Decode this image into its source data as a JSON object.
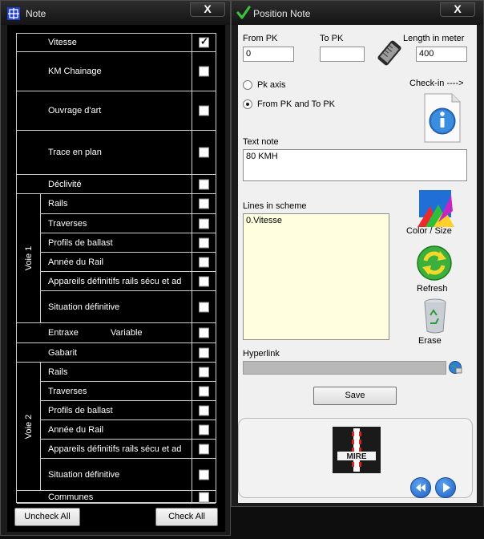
{
  "note_window": {
    "title": "Note",
    "close_label": "X",
    "rows": [
      {
        "label": "Vitesse",
        "checked": true
      },
      {
        "label": "KM Chainage",
        "checked": false
      },
      {
        "label": "Ouvrage d'art",
        "checked": false
      },
      {
        "label": "Trace en plan",
        "checked": false
      },
      {
        "label": "Déclivité",
        "checked": false
      },
      {
        "label": "Rails",
        "checked": false
      },
      {
        "label": "Traverses",
        "checked": false
      },
      {
        "label": "Profils de ballast",
        "checked": false
      },
      {
        "label": "Année du Rail",
        "checked": false
      },
      {
        "label": "Appareils définitifs rails sécu et ad",
        "checked": false
      },
      {
        "label": "Situation définitive",
        "checked": false
      },
      {
        "label": "Entraxe",
        "extra": "Variable",
        "checked": false
      },
      {
        "label": "Gabarit",
        "checked": false
      },
      {
        "label": "Rails",
        "checked": false
      },
      {
        "label": "Traverses",
        "checked": false
      },
      {
        "label": "Profils de ballast",
        "checked": false
      },
      {
        "label": "Année du Rail",
        "checked": false
      },
      {
        "label": "Appareils définitifs rails sécu et ad",
        "checked": false
      },
      {
        "label": "Situation définitive",
        "checked": false
      },
      {
        "label": "Communes",
        "checked": false
      }
    ],
    "groups": [
      "Voie 1",
      "Voie 2"
    ],
    "uncheck_all": "Uncheck All",
    "check_all": "Check All"
  },
  "position_window": {
    "title": "Position Note",
    "close_label": "X",
    "from_pk_label": "From PK",
    "from_pk_value": "0",
    "to_pk_label": "To PK",
    "to_pk_value": "",
    "length_label": "Length in meter",
    "length_value": "400",
    "radio_pk_axis": "Pk axis",
    "radio_from_to": "From PK and To PK",
    "checkin_label": "Check-in ---->",
    "text_note_label": "Text note",
    "text_note_value": "80 KMH",
    "lines_label": "Lines in scheme",
    "lines": [
      "0.Vitesse"
    ],
    "color_size": "Color / Size",
    "refresh": "Refresh",
    "erase": "Erase",
    "hyperlink_label": "Hyperlink",
    "hyperlink_value": "",
    "save": "Save",
    "logo_text": "MIRE",
    "colors": {
      "lines_bg": "#ffffe0",
      "title_bg": "#1a1a1a",
      "accent_green": "#2e9e2e"
    }
  }
}
